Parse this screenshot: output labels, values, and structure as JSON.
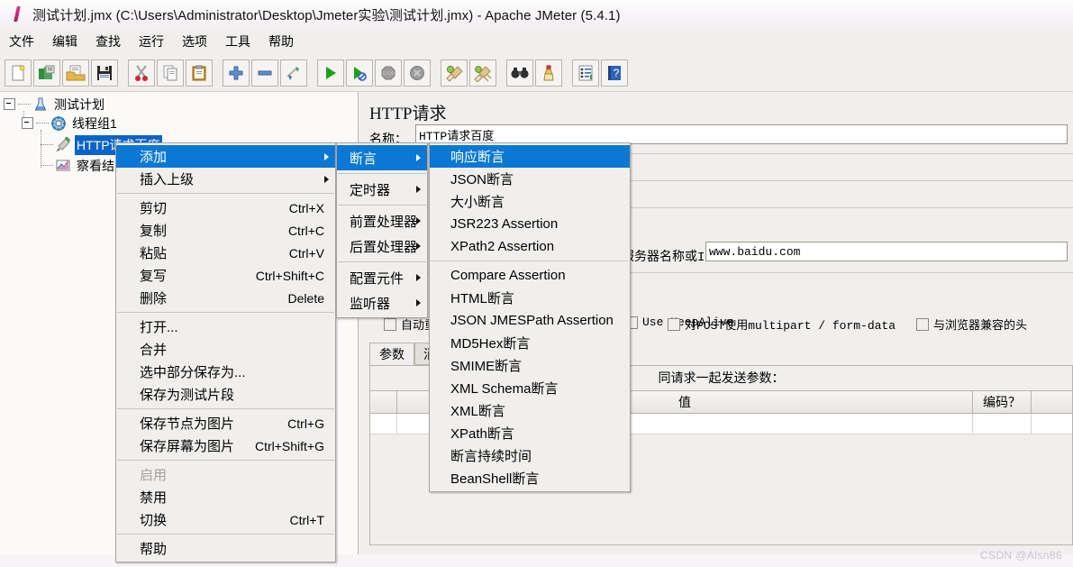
{
  "window": {
    "title": "测试计划.jmx (C:\\Users\\Administrator\\Desktop\\Jmeter实验\\测试计划.jmx) - Apache JMeter (5.4.1)",
    "app_icon": "jmeter-feather-icon"
  },
  "menubar": {
    "items": [
      {
        "label": "文件",
        "name": "menu-file"
      },
      {
        "label": "编辑",
        "name": "menu-edit"
      },
      {
        "label": "查找",
        "name": "menu-search"
      },
      {
        "label": "运行",
        "name": "menu-run"
      },
      {
        "label": "选项",
        "name": "menu-options"
      },
      {
        "label": "工具",
        "name": "menu-tools"
      },
      {
        "label": "帮助",
        "name": "menu-help"
      }
    ]
  },
  "toolbar": {
    "buttons": [
      {
        "icon": "new-document-icon",
        "name": "new-test-plan-button"
      },
      {
        "icon": "templates-icon",
        "name": "templates-button"
      },
      {
        "icon": "open-folder-icon",
        "name": "open-button"
      },
      {
        "icon": "save-floppy-icon",
        "name": "save-button"
      },
      {
        "icon": "scissors-icon",
        "name": "cut-button"
      },
      {
        "icon": "copy-pages-icon",
        "name": "copy-button"
      },
      {
        "icon": "clipboard-icon",
        "name": "paste-button"
      },
      {
        "icon": "plus-icon",
        "name": "expand-all-button"
      },
      {
        "icon": "minus-icon",
        "name": "collapse-all-button"
      },
      {
        "icon": "toggle-icon",
        "name": "toggle-button"
      },
      {
        "icon": "play-green-icon",
        "name": "start-button"
      },
      {
        "icon": "play-no-pauses-icon",
        "name": "start-no-pauses-button"
      },
      {
        "icon": "stop-sign-icon",
        "name": "stop-button"
      },
      {
        "icon": "shutdown-icon",
        "name": "shutdown-button"
      },
      {
        "icon": "clear-broom-icon",
        "name": "clear-button"
      },
      {
        "icon": "clear-all-broom-icon",
        "name": "clear-all-button"
      },
      {
        "icon": "binoculars-icon",
        "name": "search-button"
      },
      {
        "icon": "reset-broom-icon",
        "name": "reset-search-button"
      },
      {
        "icon": "function-helper-icon",
        "name": "function-helper-button"
      },
      {
        "icon": "help-book-icon",
        "name": "help-button"
      }
    ]
  },
  "tree": {
    "nodes": [
      {
        "label": "测试计划",
        "icon": "test-plan-icon",
        "selected": false,
        "name": "tree-node-test-plan"
      },
      {
        "label": "线程组1",
        "icon": "thread-group-icon",
        "selected": false,
        "name": "tree-node-thread-group"
      },
      {
        "label": "HTTP请求百度",
        "icon": "http-request-icon",
        "selected": true,
        "name": "tree-node-http-request"
      },
      {
        "label": "察看结果树",
        "icon": "view-results-tree-icon",
        "selected": false,
        "name": "tree-node-view-results-tree"
      }
    ]
  },
  "context_menu": {
    "items": [
      {
        "label": "添加",
        "accel": "",
        "submenu": true,
        "highlighted": true,
        "disabled": false,
        "name": "ctx-add"
      },
      {
        "label": "插入上级",
        "accel": "",
        "submenu": true,
        "highlighted": false,
        "disabled": false,
        "name": "ctx-insert-parent"
      },
      {
        "sep": true
      },
      {
        "label": "剪切",
        "accel": "Ctrl+X",
        "name": "ctx-cut"
      },
      {
        "label": "复制",
        "accel": "Ctrl+C",
        "name": "ctx-copy"
      },
      {
        "label": "粘贴",
        "accel": "Ctrl+V",
        "name": "ctx-paste"
      },
      {
        "label": "复写",
        "accel": "Ctrl+Shift+C",
        "name": "ctx-duplicate"
      },
      {
        "label": "删除",
        "accel": "Delete",
        "name": "ctx-delete"
      },
      {
        "sep": true
      },
      {
        "label": "打开...",
        "accel": "",
        "name": "ctx-open"
      },
      {
        "label": "合并",
        "accel": "",
        "name": "ctx-merge"
      },
      {
        "label": "选中部分保存为...",
        "accel": "",
        "name": "ctx-save-selection-as"
      },
      {
        "label": "保存为测试片段",
        "accel": "",
        "name": "ctx-save-as-test-fragment"
      },
      {
        "sep": true
      },
      {
        "label": "保存节点为图片",
        "accel": "Ctrl+G",
        "name": "ctx-save-node-as-image"
      },
      {
        "label": "保存屏幕为图片",
        "accel": "Ctrl+Shift+G",
        "name": "ctx-save-screen-as-image"
      },
      {
        "sep": true
      },
      {
        "label": "启用",
        "accel": "",
        "disabled": true,
        "name": "ctx-enable"
      },
      {
        "label": "禁用",
        "accel": "",
        "name": "ctx-disable"
      },
      {
        "label": "切换",
        "accel": "Ctrl+T",
        "name": "ctx-toggle"
      },
      {
        "sep": true
      },
      {
        "label": "帮助",
        "accel": "",
        "name": "ctx-help"
      }
    ]
  },
  "submenu_add": {
    "items": [
      {
        "label": "断言",
        "submenu": true,
        "highlighted": true,
        "name": "add-assertions"
      },
      {
        "sep": true
      },
      {
        "label": "定时器",
        "submenu": true,
        "name": "add-timer"
      },
      {
        "sep": true
      },
      {
        "label": "前置处理器",
        "submenu": true,
        "name": "add-pre-processors"
      },
      {
        "label": "后置处理器",
        "submenu": true,
        "name": "add-post-processors"
      },
      {
        "sep": true
      },
      {
        "label": "配置元件",
        "submenu": true,
        "name": "add-config-element"
      },
      {
        "label": "监听器",
        "submenu": true,
        "name": "add-listener"
      }
    ]
  },
  "submenu_assertion": {
    "items": [
      {
        "label": "响应断言",
        "highlighted": true,
        "name": "assertion-response"
      },
      {
        "label": "JSON断言",
        "name": "assertion-json"
      },
      {
        "label": "大小断言",
        "name": "assertion-size"
      },
      {
        "label": "JSR223 Assertion",
        "name": "assertion-jsr223"
      },
      {
        "label": "XPath2 Assertion",
        "name": "assertion-xpath2"
      },
      {
        "sep": true
      },
      {
        "label": "Compare Assertion",
        "name": "assertion-compare"
      },
      {
        "label": "HTML断言",
        "name": "assertion-html"
      },
      {
        "label": "JSON JMESPath Assertion",
        "name": "assertion-json-jmespath"
      },
      {
        "label": "MD5Hex断言",
        "name": "assertion-md5hex"
      },
      {
        "label": "SMIME断言",
        "name": "assertion-smime"
      },
      {
        "label": "XML Schema断言",
        "name": "assertion-xml-schema"
      },
      {
        "label": "XML断言",
        "name": "assertion-xml"
      },
      {
        "label": "XPath断言",
        "name": "assertion-xpath"
      },
      {
        "label": "断言持续时间",
        "name": "assertion-duration"
      },
      {
        "label": "BeanShell断言",
        "name": "assertion-beanshell"
      }
    ]
  },
  "panel": {
    "title": "HTTP请求",
    "name_label": "名称：",
    "name_value": "HTTP请求百度",
    "server_label": "服务器名称或IP：",
    "server_value": "www.baidu.com",
    "checkboxes": [
      {
        "label": "自动重定向",
        "checked": false,
        "name": "checkbox-follow-redirects-auto"
      },
      {
        "label": "Use KeepAlive",
        "checked": false,
        "name": "checkbox-use-keepalive"
      },
      {
        "label": "对POST使用multipart / form-data",
        "checked": false,
        "name": "checkbox-multipart-form-data"
      },
      {
        "label": "与浏览器兼容的头",
        "checked": false,
        "name": "checkbox-browser-compatible-headers"
      }
    ],
    "tabs": [
      {
        "label": "参数",
        "active": true,
        "name": "tab-parameters"
      },
      {
        "label": "消息体数据",
        "active": false,
        "name": "tab-body-data"
      }
    ],
    "params_header": "同请求一起发送参数：",
    "params_columns": [
      "",
      "值",
      "编码？",
      ""
    ],
    "params_rows": []
  },
  "watermark": "CSDN @Alsn86",
  "colors": {
    "accent": "#0a78d4",
    "selection": "#0a64c8",
    "panel_bg": "#f0efee",
    "border": "#b9b4ab"
  }
}
